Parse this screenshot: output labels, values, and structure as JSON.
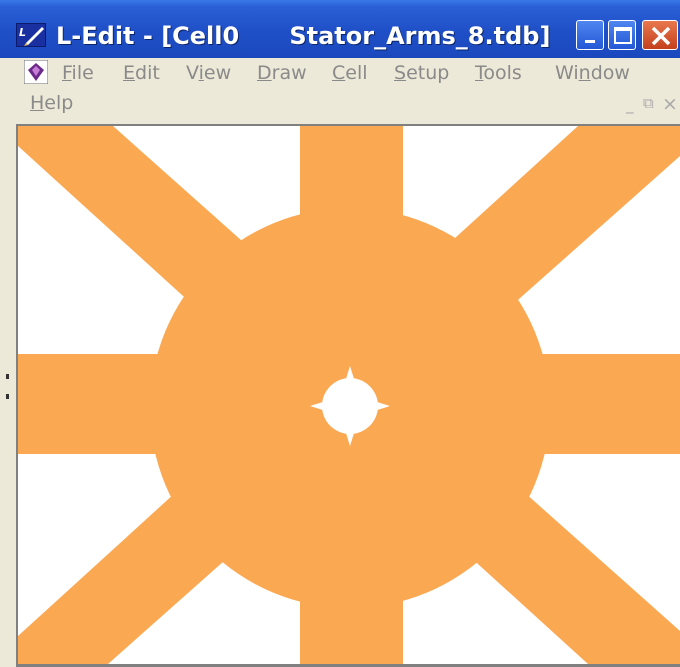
{
  "window": {
    "title": "L-Edit - [Cell0      Stator_Arms_8.tdb]",
    "app_icon": "ledit-app-icon",
    "buttons": {
      "minimize": "minimize-icon",
      "maximize": "maximize-icon",
      "close": "close-icon"
    }
  },
  "menubar": {
    "doc_icon": "cell-document-icon",
    "items": [
      {
        "label_u": "F",
        "label_rest": "ile"
      },
      {
        "label_u": "E",
        "label_rest": "dit"
      },
      {
        "label_pre": "V",
        "label_u": "i",
        "label_rest": "ew"
      },
      {
        "label_u": "D",
        "label_rest": "raw"
      },
      {
        "label_u": "C",
        "label_rest": "ell"
      },
      {
        "label_u": "S",
        "label_rest": "etup"
      },
      {
        "label_u": "T",
        "label_rest": "ools"
      },
      {
        "label_pre": "Wi",
        "label_u": "n",
        "label_rest": "dow"
      },
      {
        "label_u": "H",
        "label_rest": "elp"
      }
    ],
    "mdi_minimize": "_",
    "mdi_restore": "⧉",
    "mdi_close": "×"
  },
  "canvas": {
    "layout_name": "Stator_Arms_8",
    "fill_color": "#fba852",
    "background_color": "#ffffff",
    "arm_count": 8
  },
  "colors": {
    "titlebar": "#1f4fc7",
    "menubar": "#ece9d8",
    "menu_text_disabled": "#8a8a8a",
    "layer_orange": "#fba852"
  }
}
